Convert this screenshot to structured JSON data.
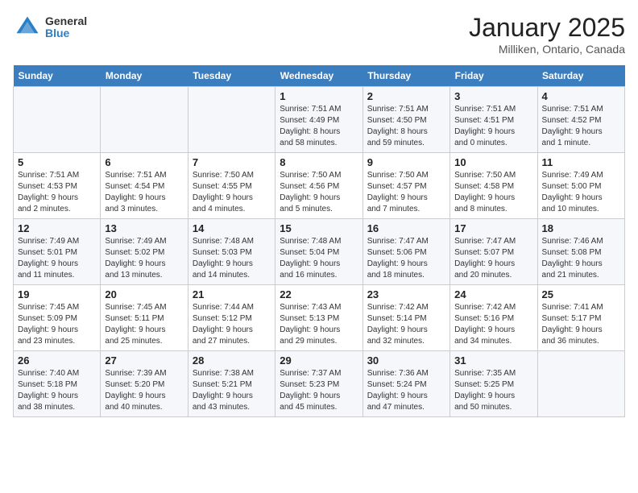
{
  "header": {
    "logo_line1": "General",
    "logo_line2": "Blue",
    "title": "January 2025",
    "subtitle": "Milliken, Ontario, Canada"
  },
  "weekdays": [
    "Sunday",
    "Monday",
    "Tuesday",
    "Wednesday",
    "Thursday",
    "Friday",
    "Saturday"
  ],
  "weeks": [
    [
      {
        "day": "",
        "info": ""
      },
      {
        "day": "",
        "info": ""
      },
      {
        "day": "",
        "info": ""
      },
      {
        "day": "1",
        "info": "Sunrise: 7:51 AM\nSunset: 4:49 PM\nDaylight: 8 hours\nand 58 minutes."
      },
      {
        "day": "2",
        "info": "Sunrise: 7:51 AM\nSunset: 4:50 PM\nDaylight: 8 hours\nand 59 minutes."
      },
      {
        "day": "3",
        "info": "Sunrise: 7:51 AM\nSunset: 4:51 PM\nDaylight: 9 hours\nand 0 minutes."
      },
      {
        "day": "4",
        "info": "Sunrise: 7:51 AM\nSunset: 4:52 PM\nDaylight: 9 hours\nand 1 minute."
      }
    ],
    [
      {
        "day": "5",
        "info": "Sunrise: 7:51 AM\nSunset: 4:53 PM\nDaylight: 9 hours\nand 2 minutes."
      },
      {
        "day": "6",
        "info": "Sunrise: 7:51 AM\nSunset: 4:54 PM\nDaylight: 9 hours\nand 3 minutes."
      },
      {
        "day": "7",
        "info": "Sunrise: 7:50 AM\nSunset: 4:55 PM\nDaylight: 9 hours\nand 4 minutes."
      },
      {
        "day": "8",
        "info": "Sunrise: 7:50 AM\nSunset: 4:56 PM\nDaylight: 9 hours\nand 5 minutes."
      },
      {
        "day": "9",
        "info": "Sunrise: 7:50 AM\nSunset: 4:57 PM\nDaylight: 9 hours\nand 7 minutes."
      },
      {
        "day": "10",
        "info": "Sunrise: 7:50 AM\nSunset: 4:58 PM\nDaylight: 9 hours\nand 8 minutes."
      },
      {
        "day": "11",
        "info": "Sunrise: 7:49 AM\nSunset: 5:00 PM\nDaylight: 9 hours\nand 10 minutes."
      }
    ],
    [
      {
        "day": "12",
        "info": "Sunrise: 7:49 AM\nSunset: 5:01 PM\nDaylight: 9 hours\nand 11 minutes."
      },
      {
        "day": "13",
        "info": "Sunrise: 7:49 AM\nSunset: 5:02 PM\nDaylight: 9 hours\nand 13 minutes."
      },
      {
        "day": "14",
        "info": "Sunrise: 7:48 AM\nSunset: 5:03 PM\nDaylight: 9 hours\nand 14 minutes."
      },
      {
        "day": "15",
        "info": "Sunrise: 7:48 AM\nSunset: 5:04 PM\nDaylight: 9 hours\nand 16 minutes."
      },
      {
        "day": "16",
        "info": "Sunrise: 7:47 AM\nSunset: 5:06 PM\nDaylight: 9 hours\nand 18 minutes."
      },
      {
        "day": "17",
        "info": "Sunrise: 7:47 AM\nSunset: 5:07 PM\nDaylight: 9 hours\nand 20 minutes."
      },
      {
        "day": "18",
        "info": "Sunrise: 7:46 AM\nSunset: 5:08 PM\nDaylight: 9 hours\nand 21 minutes."
      }
    ],
    [
      {
        "day": "19",
        "info": "Sunrise: 7:45 AM\nSunset: 5:09 PM\nDaylight: 9 hours\nand 23 minutes."
      },
      {
        "day": "20",
        "info": "Sunrise: 7:45 AM\nSunset: 5:11 PM\nDaylight: 9 hours\nand 25 minutes."
      },
      {
        "day": "21",
        "info": "Sunrise: 7:44 AM\nSunset: 5:12 PM\nDaylight: 9 hours\nand 27 minutes."
      },
      {
        "day": "22",
        "info": "Sunrise: 7:43 AM\nSunset: 5:13 PM\nDaylight: 9 hours\nand 29 minutes."
      },
      {
        "day": "23",
        "info": "Sunrise: 7:42 AM\nSunset: 5:14 PM\nDaylight: 9 hours\nand 32 minutes."
      },
      {
        "day": "24",
        "info": "Sunrise: 7:42 AM\nSunset: 5:16 PM\nDaylight: 9 hours\nand 34 minutes."
      },
      {
        "day": "25",
        "info": "Sunrise: 7:41 AM\nSunset: 5:17 PM\nDaylight: 9 hours\nand 36 minutes."
      }
    ],
    [
      {
        "day": "26",
        "info": "Sunrise: 7:40 AM\nSunset: 5:18 PM\nDaylight: 9 hours\nand 38 minutes."
      },
      {
        "day": "27",
        "info": "Sunrise: 7:39 AM\nSunset: 5:20 PM\nDaylight: 9 hours\nand 40 minutes."
      },
      {
        "day": "28",
        "info": "Sunrise: 7:38 AM\nSunset: 5:21 PM\nDaylight: 9 hours\nand 43 minutes."
      },
      {
        "day": "29",
        "info": "Sunrise: 7:37 AM\nSunset: 5:23 PM\nDaylight: 9 hours\nand 45 minutes."
      },
      {
        "day": "30",
        "info": "Sunrise: 7:36 AM\nSunset: 5:24 PM\nDaylight: 9 hours\nand 47 minutes."
      },
      {
        "day": "31",
        "info": "Sunrise: 7:35 AM\nSunset: 5:25 PM\nDaylight: 9 hours\nand 50 minutes."
      },
      {
        "day": "",
        "info": ""
      }
    ]
  ]
}
